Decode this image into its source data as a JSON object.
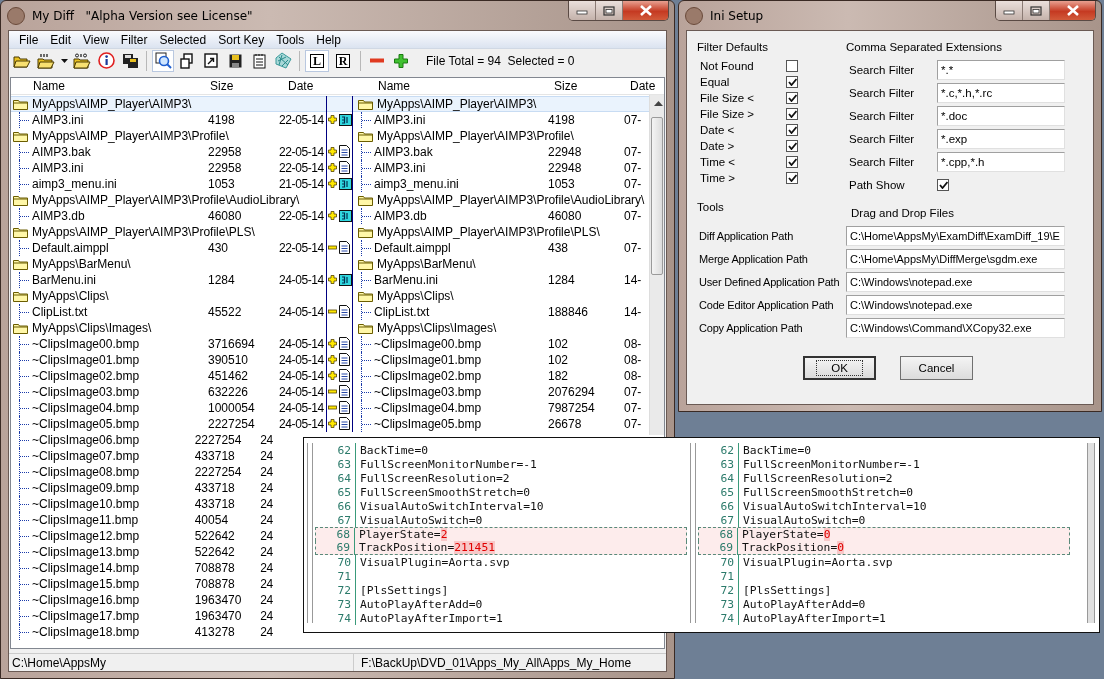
{
  "main_window": {
    "title": "My Diff   \"Alpha Version see License\"",
    "menu": [
      "File",
      "Edit",
      "View",
      "Filter",
      "Selected",
      "Sort Key",
      "Tools",
      "Help"
    ],
    "toolbar": {
      "compare_pressed": true,
      "view_buttons": [
        {
          "label": "L",
          "pressed": true
        },
        {
          "label": "R",
          "pressed": false
        }
      ],
      "status": "File Total = 94  Selected = 0"
    },
    "columns": {
      "left": [
        "Name",
        "Size",
        "Date"
      ],
      "right": [
        "Name",
        "Size",
        "Date"
      ]
    },
    "rows": [
      {
        "kind": "folder",
        "selected": true,
        "left": {
          "name": "MyApps\\AIMP_Player\\AIMP3\\"
        },
        "right": {
          "name": "MyApps\\AIMP_Player\\AIMP3\\"
        }
      },
      {
        "kind": "inifile",
        "selected": false,
        "left": {
          "name": "AIMP3.ini",
          "size": "4198",
          "date": "22-05-14"
        },
        "added": true,
        "right": {
          "name": "AIMP3.ini",
          "size": "4198",
          "date": "07-"
        }
      },
      {
        "kind": "folder",
        "selected": false,
        "left": {
          "name": "MyApps\\AIMP_Player\\AIMP3\\Profile\\"
        },
        "right": {
          "name": "MyApps\\AIMP_Player\\AIMP3\\Profile\\"
        }
      },
      {
        "kind": "docfile",
        "selected": false,
        "left": {
          "name": "AIMP3.bak",
          "size": "22958",
          "date": "22-05-14"
        },
        "added": true,
        "right": {
          "name": "AIMP3.bak",
          "size": "22948",
          "date": "07-"
        }
      },
      {
        "kind": "docfile",
        "selected": false,
        "left": {
          "name": "AIMP3.ini",
          "size": "22958",
          "date": "22-05-14"
        },
        "added": true,
        "right": {
          "name": "AIMP3.ini",
          "size": "22948",
          "date": "07-"
        }
      },
      {
        "kind": "inifile",
        "selected": false,
        "left": {
          "name": "aimp3_menu.ini",
          "size": "1053",
          "date": "21-05-14"
        },
        "added": true,
        "right": {
          "name": "aimp3_menu.ini",
          "size": "1053",
          "date": "07-"
        }
      },
      {
        "kind": "folder",
        "selected": false,
        "left": {
          "name": "MyApps\\AIMP_Player\\AIMP3\\Profile\\AudioLibrary\\"
        },
        "right": {
          "name": "MyApps\\AIMP_Player\\AIMP3\\Profile\\AudioLibrary\\"
        }
      },
      {
        "kind": "inifile",
        "selected": false,
        "left": {
          "name": "AIMP3.db",
          "size": "46080",
          "date": "22-05-14"
        },
        "added": true,
        "right": {
          "name": "AIMP3.db",
          "size": "46080",
          "date": "07-"
        }
      },
      {
        "kind": "folder",
        "selected": false,
        "left": {
          "name": "MyApps\\AIMP_Player\\AIMP3\\Profile\\PLS\\"
        },
        "right": {
          "name": "MyApps\\AIMP_Player\\AIMP3\\Profile\\PLS\\"
        }
      },
      {
        "kind": "docfile",
        "selected": false,
        "left": {
          "name": "Default.aimppl",
          "size": "430",
          "date": "22-05-14"
        },
        "added": false,
        "right": {
          "name": "Default.aimppl",
          "size": "438",
          "date": "07-"
        }
      },
      {
        "kind": "folder",
        "selected": false,
        "left": {
          "name": "MyApps\\BarMenu\\"
        },
        "right": {
          "name": "MyApps\\BarMenu\\"
        }
      },
      {
        "kind": "inifile",
        "selected": false,
        "left": {
          "name": "BarMenu.ini",
          "size": "1284",
          "date": "24-05-14"
        },
        "added": true,
        "right": {
          "name": "BarMenu.ini",
          "size": "1284",
          "date": "14-"
        }
      },
      {
        "kind": "folder",
        "selected": false,
        "left": {
          "name": "MyApps\\Clips\\"
        },
        "right": {
          "name": "MyApps\\Clips\\"
        }
      },
      {
        "kind": "docfile",
        "selected": false,
        "left": {
          "name": "ClipList.txt",
          "size": "45522",
          "date": "24-05-14"
        },
        "added": false,
        "right": {
          "name": "ClipList.txt",
          "size": "188846",
          "date": "14-"
        }
      },
      {
        "kind": "folder",
        "selected": false,
        "left": {
          "name": "MyApps\\Clips\\Images\\"
        },
        "right": {
          "name": "MyApps\\Clips\\Images\\"
        }
      },
      {
        "kind": "docfile",
        "selected": false,
        "left": {
          "name": "~ClipsImage00.bmp",
          "size": "3716694",
          "date": "24-05-14"
        },
        "added": true,
        "right": {
          "name": "~ClipsImage00.bmp",
          "size": "102",
          "date": "08-"
        }
      },
      {
        "kind": "docfile",
        "selected": false,
        "left": {
          "name": "~ClipsImage01.bmp",
          "size": "390510",
          "date": "24-05-14"
        },
        "added": true,
        "right": {
          "name": "~ClipsImage01.bmp",
          "size": "102",
          "date": "08-"
        }
      },
      {
        "kind": "docfile",
        "selected": false,
        "left": {
          "name": "~ClipsImage02.bmp",
          "size": "451462",
          "date": "24-05-14"
        },
        "added": true,
        "right": {
          "name": "~ClipsImage02.bmp",
          "size": "182",
          "date": "08-"
        }
      },
      {
        "kind": "docfile",
        "selected": false,
        "left": {
          "name": "~ClipsImage03.bmp",
          "size": "632226",
          "date": "24-05-14"
        },
        "added": false,
        "right": {
          "name": "~ClipsImage03.bmp",
          "size": "2076294",
          "date": "07-"
        }
      },
      {
        "kind": "docfile",
        "selected": false,
        "left": {
          "name": "~ClipsImage04.bmp",
          "size": "1000054",
          "date": "24-05-14"
        },
        "added": false,
        "right": {
          "name": "~ClipsImage04.bmp",
          "size": "7987254",
          "date": "07-"
        }
      },
      {
        "kind": "docfile",
        "selected": false,
        "left": {
          "name": "~ClipsImage05.bmp",
          "size": "2227254",
          "date": "24-05-14"
        },
        "added": true,
        "right": {
          "name": "~ClipsImage05.bmp",
          "size": "26678",
          "date": "07-"
        }
      },
      {
        "kind": "file",
        "selected": false,
        "left": {
          "name": "~ClipsImage06.bmp",
          "size": "2227254",
          "date": "24"
        }
      },
      {
        "kind": "file",
        "selected": false,
        "left": {
          "name": "~ClipsImage07.bmp",
          "size": "433718",
          "date": "24"
        }
      },
      {
        "kind": "file",
        "selected": false,
        "left": {
          "name": "~ClipsImage08.bmp",
          "size": "2227254",
          "date": "24"
        }
      },
      {
        "kind": "file",
        "selected": false,
        "left": {
          "name": "~ClipsImage09.bmp",
          "size": "433718",
          "date": "24"
        }
      },
      {
        "kind": "file",
        "selected": false,
        "left": {
          "name": "~ClipsImage10.bmp",
          "size": "433718",
          "date": "24"
        }
      },
      {
        "kind": "file",
        "selected": false,
        "left": {
          "name": "~ClipsImage11.bmp",
          "size": "40054",
          "date": "24"
        }
      },
      {
        "kind": "file",
        "selected": false,
        "left": {
          "name": "~ClipsImage12.bmp",
          "size": "522642",
          "date": "24"
        }
      },
      {
        "kind": "file",
        "selected": false,
        "left": {
          "name": "~ClipsImage13.bmp",
          "size": "522642",
          "date": "24"
        }
      },
      {
        "kind": "file",
        "selected": false,
        "left": {
          "name": "~ClipsImage14.bmp",
          "size": "708878",
          "date": "24"
        }
      },
      {
        "kind": "file",
        "selected": false,
        "left": {
          "name": "~ClipsImage15.bmp",
          "size": "708878",
          "date": "24"
        }
      },
      {
        "kind": "file",
        "selected": false,
        "left": {
          "name": "~ClipsImage16.bmp",
          "size": "1963470",
          "date": "24"
        }
      },
      {
        "kind": "file",
        "selected": false,
        "left": {
          "name": "~ClipsImage17.bmp",
          "size": "1963470",
          "date": "24"
        }
      },
      {
        "kind": "file",
        "selected": false,
        "left": {
          "name": "~ClipsImage18.bmp",
          "size": "413278",
          "date": "24"
        }
      }
    ],
    "status_bar": [
      "C:\\Home\\AppsMy",
      "F:\\BackUp\\DVD_01\\Apps_My_All\\Apps_My_Home"
    ]
  },
  "ini_setup": {
    "title": "Ini Setup",
    "filter_defaults": {
      "heading": "Filter Defaults",
      "items": [
        {
          "label": "Not Found",
          "checked": false
        },
        {
          "label": "Equal",
          "checked": true
        },
        {
          "label": "File Size <",
          "checked": true
        },
        {
          "label": "File Size >",
          "checked": true
        },
        {
          "label": "Date <",
          "checked": true
        },
        {
          "label": "Date >",
          "checked": true
        },
        {
          "label": "Time <",
          "checked": true
        },
        {
          "label": "Time >",
          "checked": true
        }
      ]
    },
    "extensions": {
      "heading": "Comma Separated Extensions",
      "filters": [
        {
          "label": "Search Filter",
          "value": "*.*"
        },
        {
          "label": "Search Filter",
          "value": "*.c,*.h,*.rc"
        },
        {
          "label": "Search Filter",
          "value": "*.doc"
        },
        {
          "label": "Search Filter",
          "value": "*.exp"
        },
        {
          "label": "Search Filter",
          "value": "*.cpp,*.h"
        }
      ],
      "path_show": {
        "label": "Path Show",
        "checked": true
      }
    },
    "tools": {
      "heading": "Tools",
      "drag_drop_label": "Drag and Drop Files",
      "paths": [
        {
          "label": "Diff Application Path",
          "value": "C:\\Home\\AppsMy\\ExamDiff\\ExamDiff_19\\E"
        },
        {
          "label": "Merge Application Path",
          "value": "C:\\Home\\AppsMy\\DiffMerge\\sgdm.exe"
        },
        {
          "label": "User Defined Application Path",
          "value": "C:\\Windows\\notepad.exe"
        },
        {
          "label": "Code Editor Application Path",
          "value": "C:\\Windows\\notepad.exe"
        },
        {
          "label": "Copy Application Path",
          "value": "C:\\Windows\\Command\\XCopy32.exe"
        }
      ]
    },
    "buttons": [
      {
        "label": "OK",
        "default": true
      },
      {
        "label": "Cancel",
        "default": false
      }
    ]
  },
  "diff_view": {
    "left": [
      {
        "number": "62",
        "text": "BackTime=0",
        "changed": false
      },
      {
        "number": "63",
        "text": "FullScreenMonitorNumber=-1",
        "changed": false
      },
      {
        "number": "64",
        "text": "FullScreenResolution=2",
        "changed": false
      },
      {
        "number": "65",
        "text": "FullScreenSmoothStretch=0",
        "changed": false
      },
      {
        "number": "66",
        "text": "VisualAutoSwitchInterval=10",
        "changed": false
      },
      {
        "number": "67",
        "text": "VisualAutoSwitch=0",
        "changed": false
      },
      {
        "number": "68",
        "text": "PlayerState=",
        "changed": true,
        "changed_text": "2"
      },
      {
        "number": "69",
        "text": "TrackPosition=",
        "changed": true,
        "changed_text": "211451"
      },
      {
        "number": "70",
        "text": "VisualPlugin=Aorta.svp",
        "changed": false
      },
      {
        "number": "71",
        "changed": false
      },
      {
        "number": "72",
        "text": "[PlsSettings]",
        "changed": false
      },
      {
        "number": "73",
        "text": "AutoPlayAfterAdd=0",
        "changed": false
      },
      {
        "number": "74",
        "text": "AutoPlayAfterImport=1",
        "changed": false
      }
    ],
    "right": [
      {
        "number": "62",
        "text": "BackTime=0",
        "changed": false
      },
      {
        "number": "63",
        "text": "FullScreenMonitorNumber=-1",
        "changed": false
      },
      {
        "number": "64",
        "text": "FullScreenResolution=2",
        "changed": false
      },
      {
        "number": "65",
        "text": "FullScreenSmoothStretch=0",
        "changed": false
      },
      {
        "number": "66",
        "text": "VisualAutoSwitchInterval=10",
        "changed": false
      },
      {
        "number": "67",
        "text": "VisualAutoSwitch=0",
        "changed": false
      },
      {
        "number": "68",
        "text": "PlayerState=",
        "changed": true,
        "changed_text": "0"
      },
      {
        "number": "69",
        "text": "TrackPosition=",
        "changed": true,
        "changed_text": "0"
      },
      {
        "number": "70",
        "text": "VisualPlugin=Aorta.svp",
        "changed": false
      },
      {
        "number": "71",
        "changed": false
      },
      {
        "number": "72",
        "text": "[PlsSettings]",
        "changed": false
      },
      {
        "number": "73",
        "text": "AutoPlayAfterAdd=0",
        "changed": false
      },
      {
        "number": "74",
        "text": "AutoPlayAfterImport=1",
        "changed": false
      }
    ]
  }
}
